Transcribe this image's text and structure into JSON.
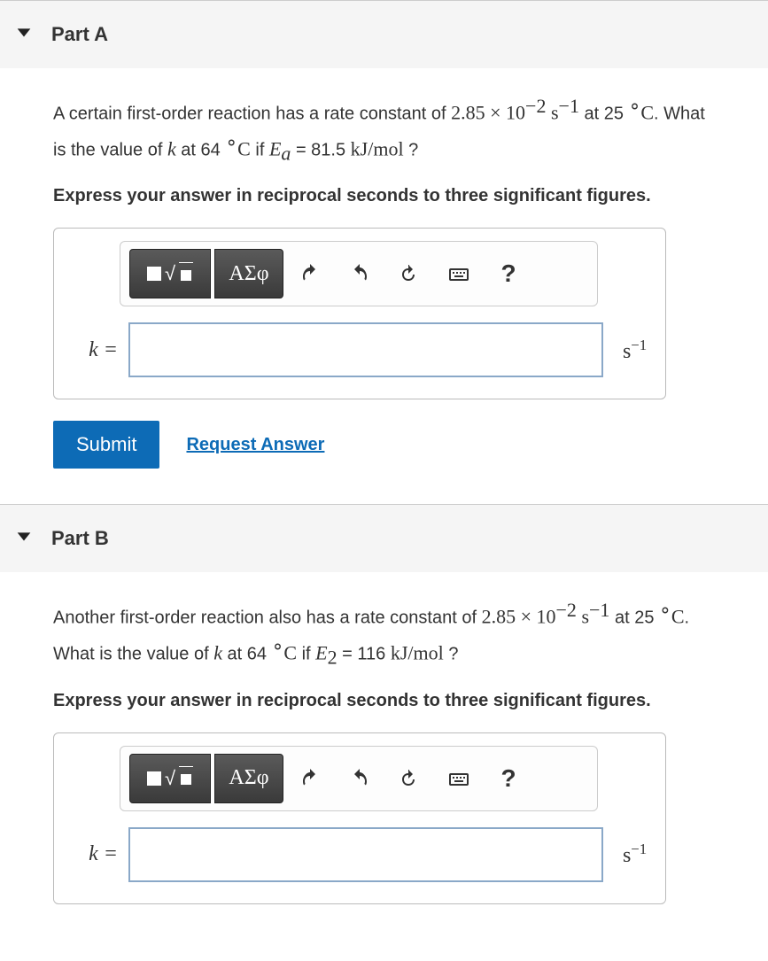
{
  "partA": {
    "title": "Part A",
    "q_pre": "A certain first-order reaction has a rate constant of ",
    "rate_const": "2.85 × 10",
    "rate_exp": "−2",
    "s_unit": "s",
    "s_exp": "−1",
    "at25": " at 25 ",
    "deg": "∘",
    "C": "C",
    "period": ". What is the value of ",
    "k": "k",
    "at64": " at 64 ",
    "if": " if ",
    "E": "E",
    "Esub": "a",
    "eq": " = 81.5 ",
    "kjmol": "kJ/mol",
    "qmark": " ?",
    "instruct": "Express your answer in reciprocal seconds to three significant figures.",
    "varlabel": "k =",
    "unit_s": "s",
    "unit_exp": "−1",
    "submit": "Submit",
    "request": "Request Answer",
    "greek": "ΑΣφ"
  },
  "partB": {
    "title": "Part B",
    "q_pre": "Another first-order reaction also has a rate constant of ",
    "rate_const": "2.85 × 10",
    "rate_exp": "−2",
    "s_unit": "s",
    "s_exp": "−1",
    "at25": " at 25 ",
    "deg": "∘",
    "C": "C",
    "period": ". What is the value of ",
    "k": "k",
    "at64": " at 64 ",
    "if": " if ",
    "E": "E",
    "Esub": "2",
    "eq": " = 116 ",
    "kjmol": "kJ/mol",
    "qmark": " ?",
    "instruct": "Express your answer in reciprocal seconds to three significant figures.",
    "varlabel": "k =",
    "unit_s": "s",
    "unit_exp": "−1",
    "greek": "ΑΣφ"
  }
}
